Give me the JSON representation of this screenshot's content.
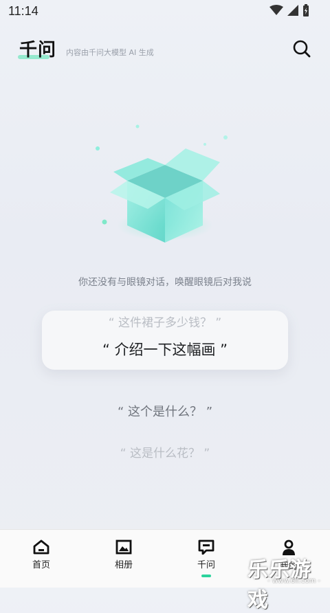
{
  "status": {
    "time": "11:14"
  },
  "header": {
    "brand": "千问",
    "subtitle": "内容由千问大模型 AI 生成"
  },
  "main": {
    "hint": "你还没有与眼镜对话，唤醒眼镜后对我说",
    "prompts": [
      "“ 这件裙子多少钱？ ”",
      "“ 介绍一下这幅画 ”",
      "“ 这个是什么？ ”",
      "“ 这是什么花？ ”"
    ]
  },
  "tabs": [
    {
      "label": "首页",
      "icon": "home-icon"
    },
    {
      "label": "相册",
      "icon": "gallery-icon"
    },
    {
      "label": "千问",
      "icon": "chat-icon",
      "active": true
    },
    {
      "label": "我的",
      "icon": "person-icon"
    }
  ],
  "watermark": {
    "text": "乐乐游戏",
    "url": "- www.6ll.com -"
  },
  "colors": {
    "accent": "#2bd39c",
    "box": "#7fe5d8"
  }
}
